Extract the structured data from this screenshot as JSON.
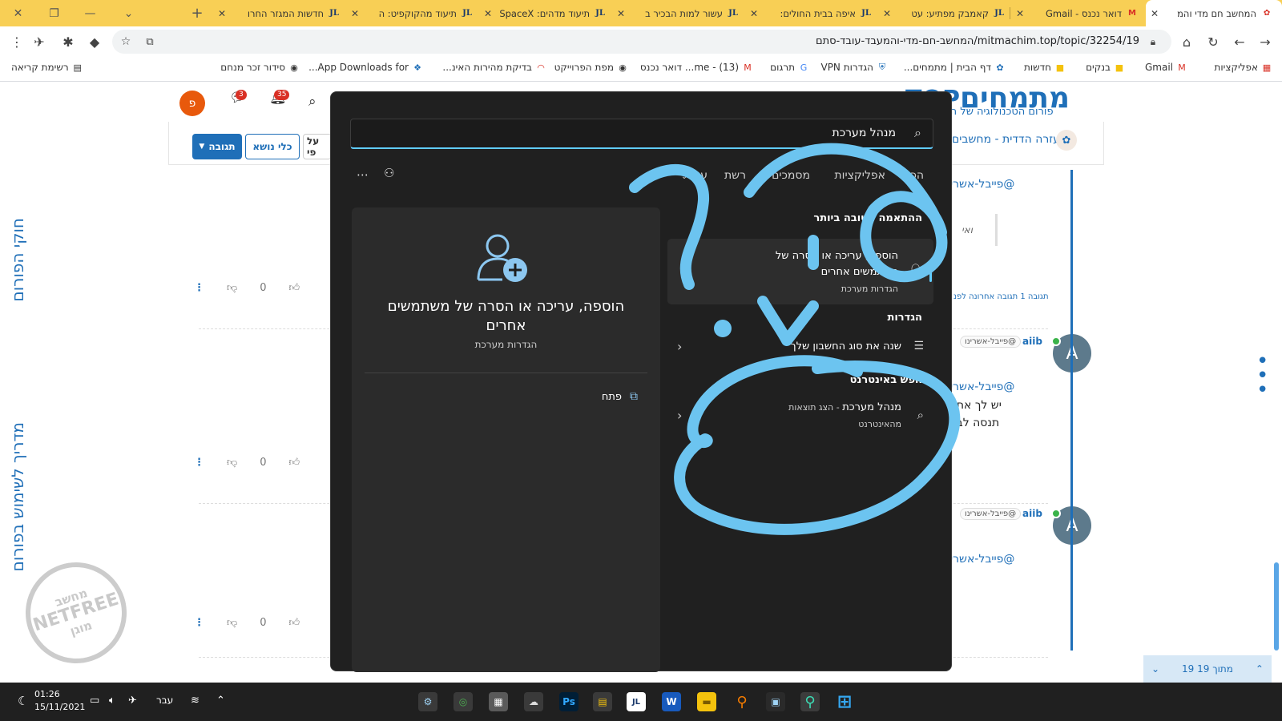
{
  "tabs": [
    {
      "title": "המחשב חם מדי והמ",
      "favicon": "forum",
      "active": true
    },
    {
      "title": "דואר נכנס - Gmail",
      "favicon": "gmail"
    },
    {
      "title": "קאמבק מפתיע: עט",
      "favicon": "jdn"
    },
    {
      "title": "איפה בבית החולים:",
      "favicon": "jdn"
    },
    {
      "title": "עשור למות הבכיר ב",
      "favicon": "jdn"
    },
    {
      "title": "תיעוד מדהים: SpaceX",
      "favicon": "jdn"
    },
    {
      "title": "תיעוד מהקוקפיט: ה",
      "favicon": "jdn"
    },
    {
      "title": "חדשות המגזר החרו",
      "favicon": "jdn"
    }
  ],
  "new_tab_symbol": "+",
  "address": {
    "url": "mitmachim.top/topic/32254/19/המחשב-חם-מדי-והמעבד-עובד-סתם"
  },
  "bookmarks": [
    {
      "label": "אפליקציות",
      "icon": "apps-grid"
    },
    {
      "label": "Gmail",
      "icon": "gmail"
    },
    {
      "label": "בנקים",
      "icon": "folder"
    },
    {
      "label": "חדשות",
      "icon": "folder"
    },
    {
      "label": "דף הבית | מתמחים...",
      "icon": "forum"
    },
    {
      "label": "הגדרות VPN",
      "icon": "vpn"
    },
    {
      "label": "תרגום",
      "icon": "translate"
    },
    {
      "label": "(13) - me... דואר נכנס",
      "icon": "gmail"
    },
    {
      "label": "מפת הפרוייקט",
      "icon": "globe"
    },
    {
      "label": "בדיקת מהירות האינ...",
      "icon": "speed"
    },
    {
      "label": "App Downloads for...",
      "icon": "dl"
    },
    {
      "label": "סידור זכר מנחם",
      "icon": "globe"
    },
    {
      "label": "רשימת קריאה",
      "icon": "reading-list"
    }
  ],
  "forum": {
    "logo": "מתמחים",
    "logo_suffix": "TOP",
    "tagline": "פורום הטכנולוגיה של הציבו",
    "avatar_letter": "פ",
    "chat_badge": "3",
    "notif_badge": "35",
    "buttons": {
      "reply": "תגובה",
      "topic_tools": "כלי נושא",
      "sort": "על פי"
    },
    "category": "עזרה הדדית - מחשבים",
    "side_link_1": "חוקי הפורום",
    "side_link_2": "מדריך לשימוש בפורום",
    "mention": "@פייבל-אשרי",
    "mention_short": "@פייבל-אשרינו",
    "post_text_1": "יש לך אחר",
    "post_text_2": "תנסה לבד",
    "italic_snip": "ואי",
    "reply_meta": "תגובה 1 תגובה אחרונה לפנ",
    "user": "aiib",
    "user_avatar": "A",
    "vote_count": "0",
    "pager": "19 מתוך 19",
    "netfree_top": "מחשב",
    "netfree_mid": "NETFREE",
    "netfree_bot": "מוגן"
  },
  "search_panel": {
    "query": "מנהל מערכת",
    "filters": [
      "הכל",
      "אפליקציות",
      "מסמכים",
      "רשת",
      "עוד"
    ],
    "best_match_heading": "ההתאמה הטובה ביותר",
    "best_match": {
      "title": "הוספה, עריכה או הסרה של משתמשים אחרים",
      "subtitle": "הגדרות מערכת",
      "icon": "user-add-icon"
    },
    "settings_heading": "הגדרות",
    "settings_item": "שנה את סוג החשבון שלך",
    "web_heading": "חפש באינטרנט",
    "web_item_title": "מנהל מערכת",
    "web_item_suffix": " - הצג תוצאות",
    "web_item_sub": "מהאינטרנט",
    "preview_title": "הוספה, עריכה או הסרה של משתמשים אחרים",
    "preview_subtitle": "הגדרות מערכת",
    "open_action": "פתח"
  },
  "taskbar": {
    "time": "01:26",
    "date": "15/11/2021",
    "language": "עבר",
    "apps": [
      "settings",
      "chrome",
      "calculator",
      "cloud",
      "photoshop",
      "explorer-alt",
      "jdn",
      "word",
      "file-explorer",
      "search-orange",
      "gamebar",
      "search",
      "start"
    ]
  },
  "colors": {
    "annotation": "#6cc4f0",
    "accent": "#60cdff",
    "forum_blue": "#1f6fb8",
    "tab_bar": "#f8cf55"
  }
}
